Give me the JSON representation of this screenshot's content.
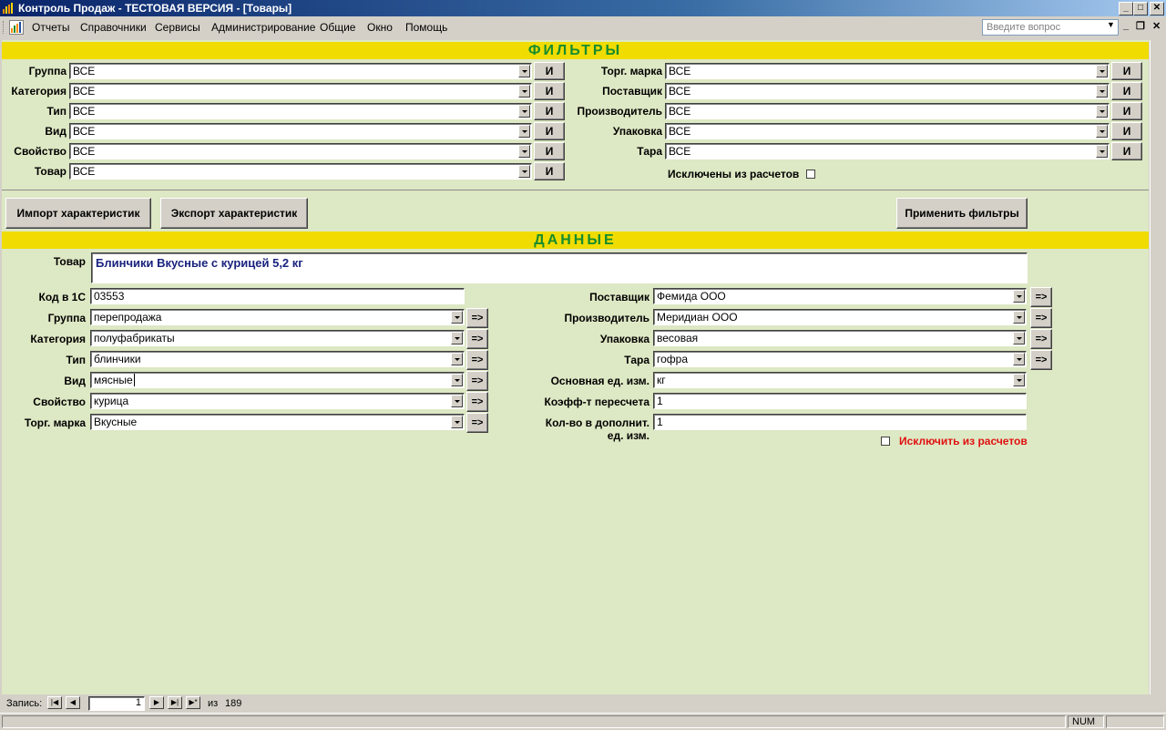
{
  "window": {
    "title": "Контроль Продаж - ТЕСТОВАЯ ВЕРСИЯ - [Товары]",
    "minimize": "_",
    "maximize": "□",
    "close": "✕"
  },
  "menubar": {
    "items": [
      "Отчеты",
      "Справочники",
      "Сервисы",
      "Администрирование",
      "Общие",
      "Окно",
      "Помощь"
    ],
    "help_placeholder": "Введите вопрос"
  },
  "filters": {
    "header": "ФИЛЬТРЫ",
    "left": [
      {
        "label": "Группа",
        "value": "ВСЕ"
      },
      {
        "label": "Категория",
        "value": "ВСЕ"
      },
      {
        "label": "Тип",
        "value": "ВСЕ"
      },
      {
        "label": "Вид",
        "value": "ВСЕ"
      },
      {
        "label": "Свойство",
        "value": "ВСЕ"
      },
      {
        "label": "Товар",
        "value": "ВСЕ"
      }
    ],
    "right": [
      {
        "label": "Торг. марка",
        "value": "ВСЕ"
      },
      {
        "label": "Поставщик",
        "value": "ВСЕ"
      },
      {
        "label": "Производитель",
        "value": "ВСЕ"
      },
      {
        "label": "Упаковка",
        "value": "ВСЕ"
      },
      {
        "label": "Тара",
        "value": "ВСЕ"
      }
    ],
    "and_button": "И",
    "excluded_label": "Исключены из расчетов"
  },
  "actions": {
    "import": "Импорт характеристик",
    "export": "Экспорт характеристик",
    "apply": "Применить фильтры"
  },
  "data": {
    "header": "ДАННЫЕ",
    "product_label": "Товар",
    "product_value": "Блинчики Вкусные с курицей 5,2 кг",
    "code_label": "Код в 1С",
    "code_value": "03553",
    "left": [
      {
        "label": "Группа",
        "value": "перепродажа"
      },
      {
        "label": "Категория",
        "value": "полуфабрикаты"
      },
      {
        "label": "Тип",
        "value": "блинчики"
      },
      {
        "label": "Вид",
        "value": "мясные"
      },
      {
        "label": "Свойство",
        "value": "курица"
      },
      {
        "label": "Торг. марка",
        "value": "Вкусные"
      }
    ],
    "right": [
      {
        "label": "Поставщик",
        "value": "Фемида ООО"
      },
      {
        "label": "Производитель",
        "value": "Меридиан ООО"
      },
      {
        "label": "Упаковка",
        "value": "весовая"
      },
      {
        "label": "Тара",
        "value": "гофра"
      },
      {
        "label": "Основная ед. изм.",
        "value": "кг"
      }
    ],
    "coef_label": "Коэфф-т пересчета",
    "coef_value": "1",
    "extra_label_1": "Кол-во в  дополнит.",
    "extra_label_2": "ед. изм.",
    "extra_value": "1",
    "go_button": "=>",
    "exclude_label": "Исключить из расчетов"
  },
  "record_nav": {
    "label": "Запись:",
    "current": "1",
    "of_label": "из",
    "total": "189"
  },
  "status": {
    "num": "NUM"
  }
}
